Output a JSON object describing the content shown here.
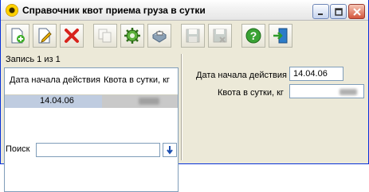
{
  "window": {
    "title": "Справочник квот приема груза в сутки"
  },
  "toolbar": {
    "buttons": [
      {
        "name": "add",
        "icon": "add-document-icon",
        "enabled": true
      },
      {
        "name": "edit",
        "icon": "edit-document-icon",
        "enabled": true
      },
      {
        "name": "delete",
        "icon": "delete-x-icon",
        "enabled": true
      },
      {
        "name": "copy",
        "icon": "copy-icon",
        "enabled": false
      },
      {
        "name": "settings",
        "icon": "gear-icon",
        "enabled": true
      },
      {
        "name": "print",
        "icon": "printer-icon",
        "enabled": true
      },
      {
        "name": "save",
        "icon": "save-disk-icon",
        "enabled": false
      },
      {
        "name": "save-close",
        "icon": "save-close-disk-icon",
        "enabled": false
      },
      {
        "name": "help",
        "icon": "help-icon",
        "enabled": true
      },
      {
        "name": "exit",
        "icon": "exit-door-icon",
        "enabled": true
      }
    ]
  },
  "list": {
    "record_label": "Запись 1 из 1",
    "columns": [
      "Дата начала действия",
      "Квота в сутки, кг"
    ],
    "rows": [
      {
        "date": "14.04.06",
        "quota": ""
      }
    ]
  },
  "search": {
    "label": "Поиск",
    "value": ""
  },
  "detail": {
    "date_label": "Дата начала действия",
    "date_value": "14.04.06",
    "quota_label": "Квота в сутки, кг",
    "quota_value": ""
  },
  "colors": {
    "window_bg": "#ece9d8",
    "selection": "#bfcce0",
    "border": "#7f9db9"
  }
}
